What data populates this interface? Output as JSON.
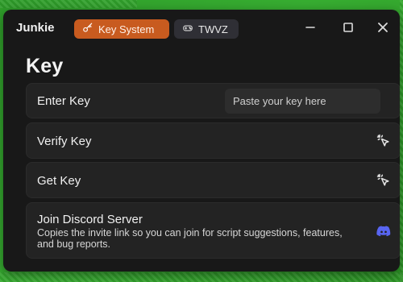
{
  "window": {
    "title": "Junkie",
    "tabs": [
      {
        "label": "Key System",
        "icon": "key-icon"
      },
      {
        "label": "TWVZ",
        "icon": "controller-icon"
      }
    ],
    "controls": {
      "minimize_icon": "minus-icon",
      "maximize_icon": "square-icon",
      "close_icon": "close-icon"
    }
  },
  "page": {
    "title": "Key"
  },
  "sections": {
    "enter_key": {
      "label": "Enter Key",
      "input_value": "",
      "input_placeholder": "Paste your key here"
    },
    "verify_key": {
      "label": "Verify Key",
      "icon": "cursor-click-icon"
    },
    "get_key": {
      "label": "Get Key",
      "icon": "cursor-click-icon"
    },
    "join_discord": {
      "label": "Join Discord Server",
      "description": "Copies the invite link so you can join for script suggestions, features, and bug reports.",
      "icon": "discord-icon"
    }
  },
  "colors": {
    "background_green": "#37ad31",
    "window_bg": "#181818",
    "panel_bg": "#232323",
    "accent_orange": "#c85b1f",
    "secondary_tab": "#2f2f35",
    "text_primary": "#f0f0f0",
    "discord_blue": "#5865f2"
  }
}
